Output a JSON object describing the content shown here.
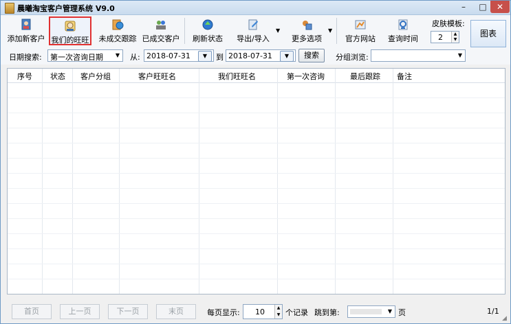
{
  "window": {
    "title": "晨曦淘宝客户管理系统 V9.0",
    "controls": {
      "minimize": "–",
      "maximize": "□",
      "close": "✕"
    }
  },
  "toolbar": {
    "buttons": [
      {
        "label": "添加新客户",
        "icon": "add-customer-icon"
      },
      {
        "label": "我们的旺旺",
        "icon": "wangwang-icon",
        "selected": true
      },
      {
        "label": "未成交跟踪",
        "icon": "track-icon"
      },
      {
        "label": "已成交客户",
        "icon": "deal-customers-icon"
      },
      {
        "label": "刷新状态",
        "icon": "refresh-icon"
      },
      {
        "label": "导出/导入",
        "icon": "export-import-icon"
      },
      {
        "label": "更多选项",
        "icon": "more-options-icon"
      },
      {
        "label": "官方网站",
        "icon": "website-icon"
      },
      {
        "label": "查询时间",
        "icon": "query-time-icon"
      }
    ],
    "skin_label": "皮肤模板:",
    "skin_value": "2",
    "chart_label": "图表"
  },
  "filter": {
    "date_search_label": "日期搜索:",
    "date_type": "第一次咨询日期",
    "from_label": "从:",
    "from_date": "2018-07-31",
    "to_label": "到",
    "to_date": "2018-07-31",
    "search_label": "搜索",
    "group_label": "分组浏览:",
    "group_value": ""
  },
  "table": {
    "columns": [
      "序号",
      "状态",
      "客户分组",
      "客户旺旺名",
      "我们旺旺名",
      "第一次咨询",
      "最后跟踪",
      "备注"
    ]
  },
  "pager": {
    "first": "首页",
    "prev": "上一页",
    "next": "下一页",
    "last": "末页",
    "per_page_label": "每页显示:",
    "per_page_value": "10",
    "records_label": "个记录",
    "jump_label": "跳到第:",
    "page_unit": "页",
    "page_info": "1/1"
  },
  "colors": {
    "accent_red": "#e03030",
    "border_blue": "#8ea6c2",
    "title_bg": "#c9dbee"
  }
}
